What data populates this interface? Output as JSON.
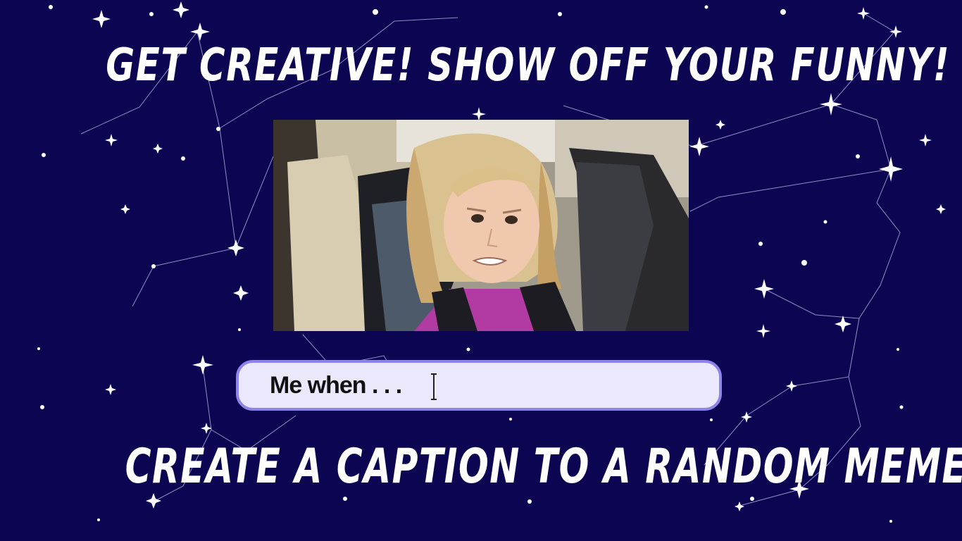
{
  "page": {
    "title_top": "GET CREATIVE! SHOW OFF YOUR FUNNY!",
    "title_bottom": "CREATE A CAPTION TO A RANDOM MEME"
  },
  "meme": {
    "image_alt": "Girl in car seat making a skeptical face"
  },
  "caption": {
    "value": "Me when . . .",
    "placeholder": ""
  },
  "colors": {
    "background": "#0c0652",
    "text": "#ffffff",
    "input_fill": "#ebe8fb",
    "input_border": "#8e83e8"
  },
  "icons": {
    "cursor": "text-cursor-icon",
    "decoration": "star-constellation-icon"
  }
}
